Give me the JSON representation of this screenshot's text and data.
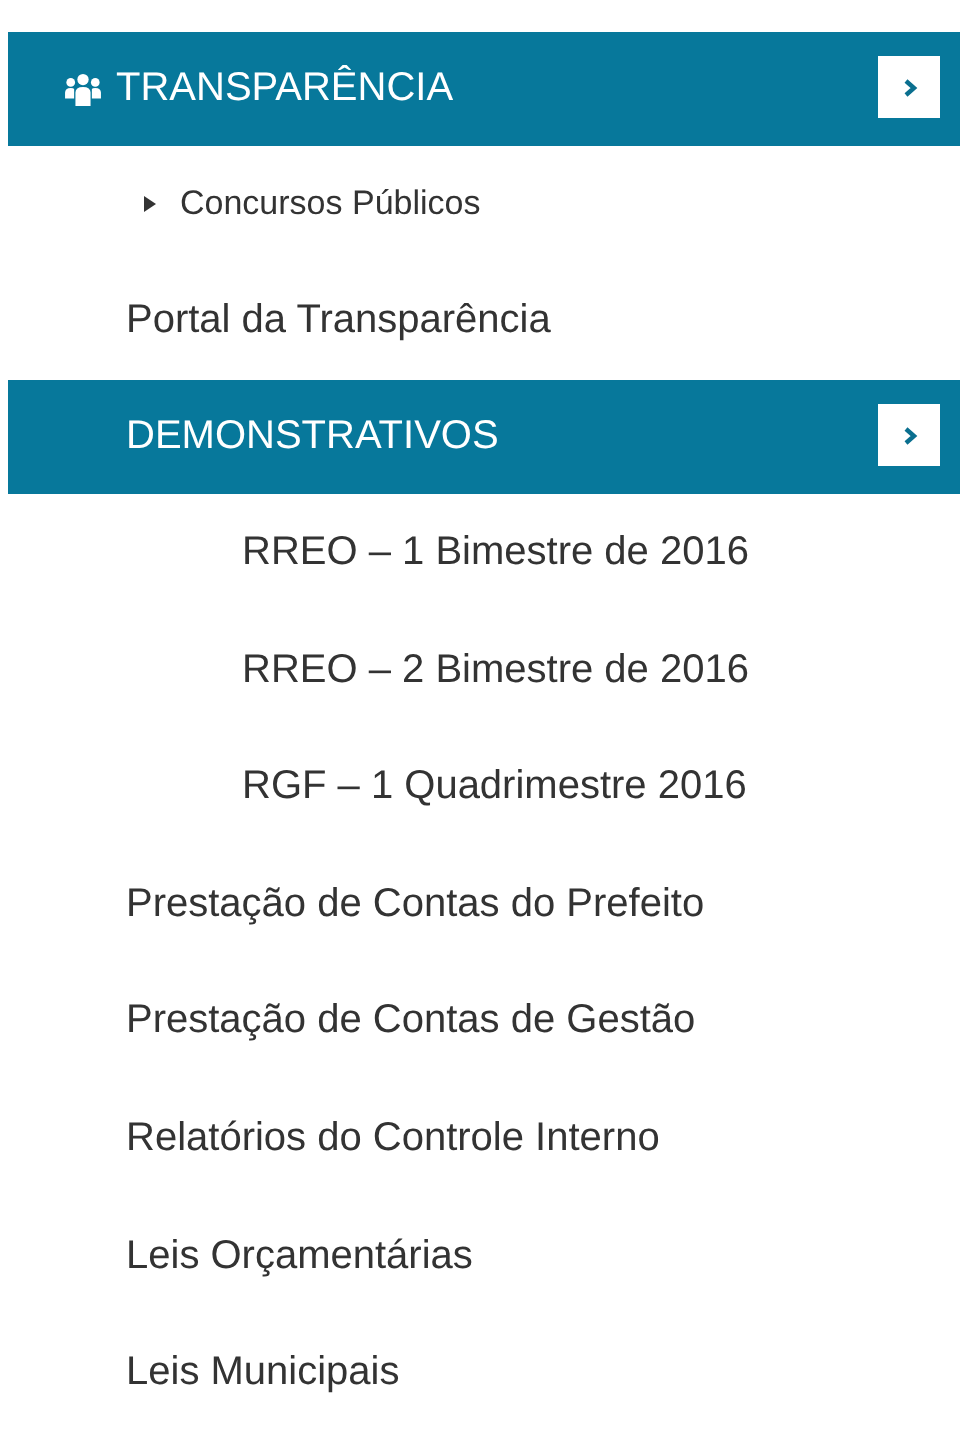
{
  "header": {
    "title": "TRANSPARÊNCIA"
  },
  "items": [
    {
      "kind": "bullet",
      "label": "Concursos Públicos"
    },
    {
      "kind": "link",
      "label": "Portal da Transparência"
    },
    {
      "kind": "section",
      "label": "DEMONSTRATIVOS",
      "children": [
        {
          "label": "RREO – 1 Bimestre de 2016"
        },
        {
          "label": "RREO – 2 Bimestre de 2016"
        },
        {
          "label": "RGF – 1 Quadrimestre 2016"
        }
      ]
    },
    {
      "kind": "link",
      "label": "Prestação de Contas do Prefeito"
    },
    {
      "kind": "link",
      "label": "Prestação de Contas de Gestão"
    },
    {
      "kind": "link",
      "label": "Relatórios do Controle Interno"
    },
    {
      "kind": "link",
      "label": "Leis Orçamentárias"
    },
    {
      "kind": "link",
      "label": "Leis Municipais"
    }
  ]
}
